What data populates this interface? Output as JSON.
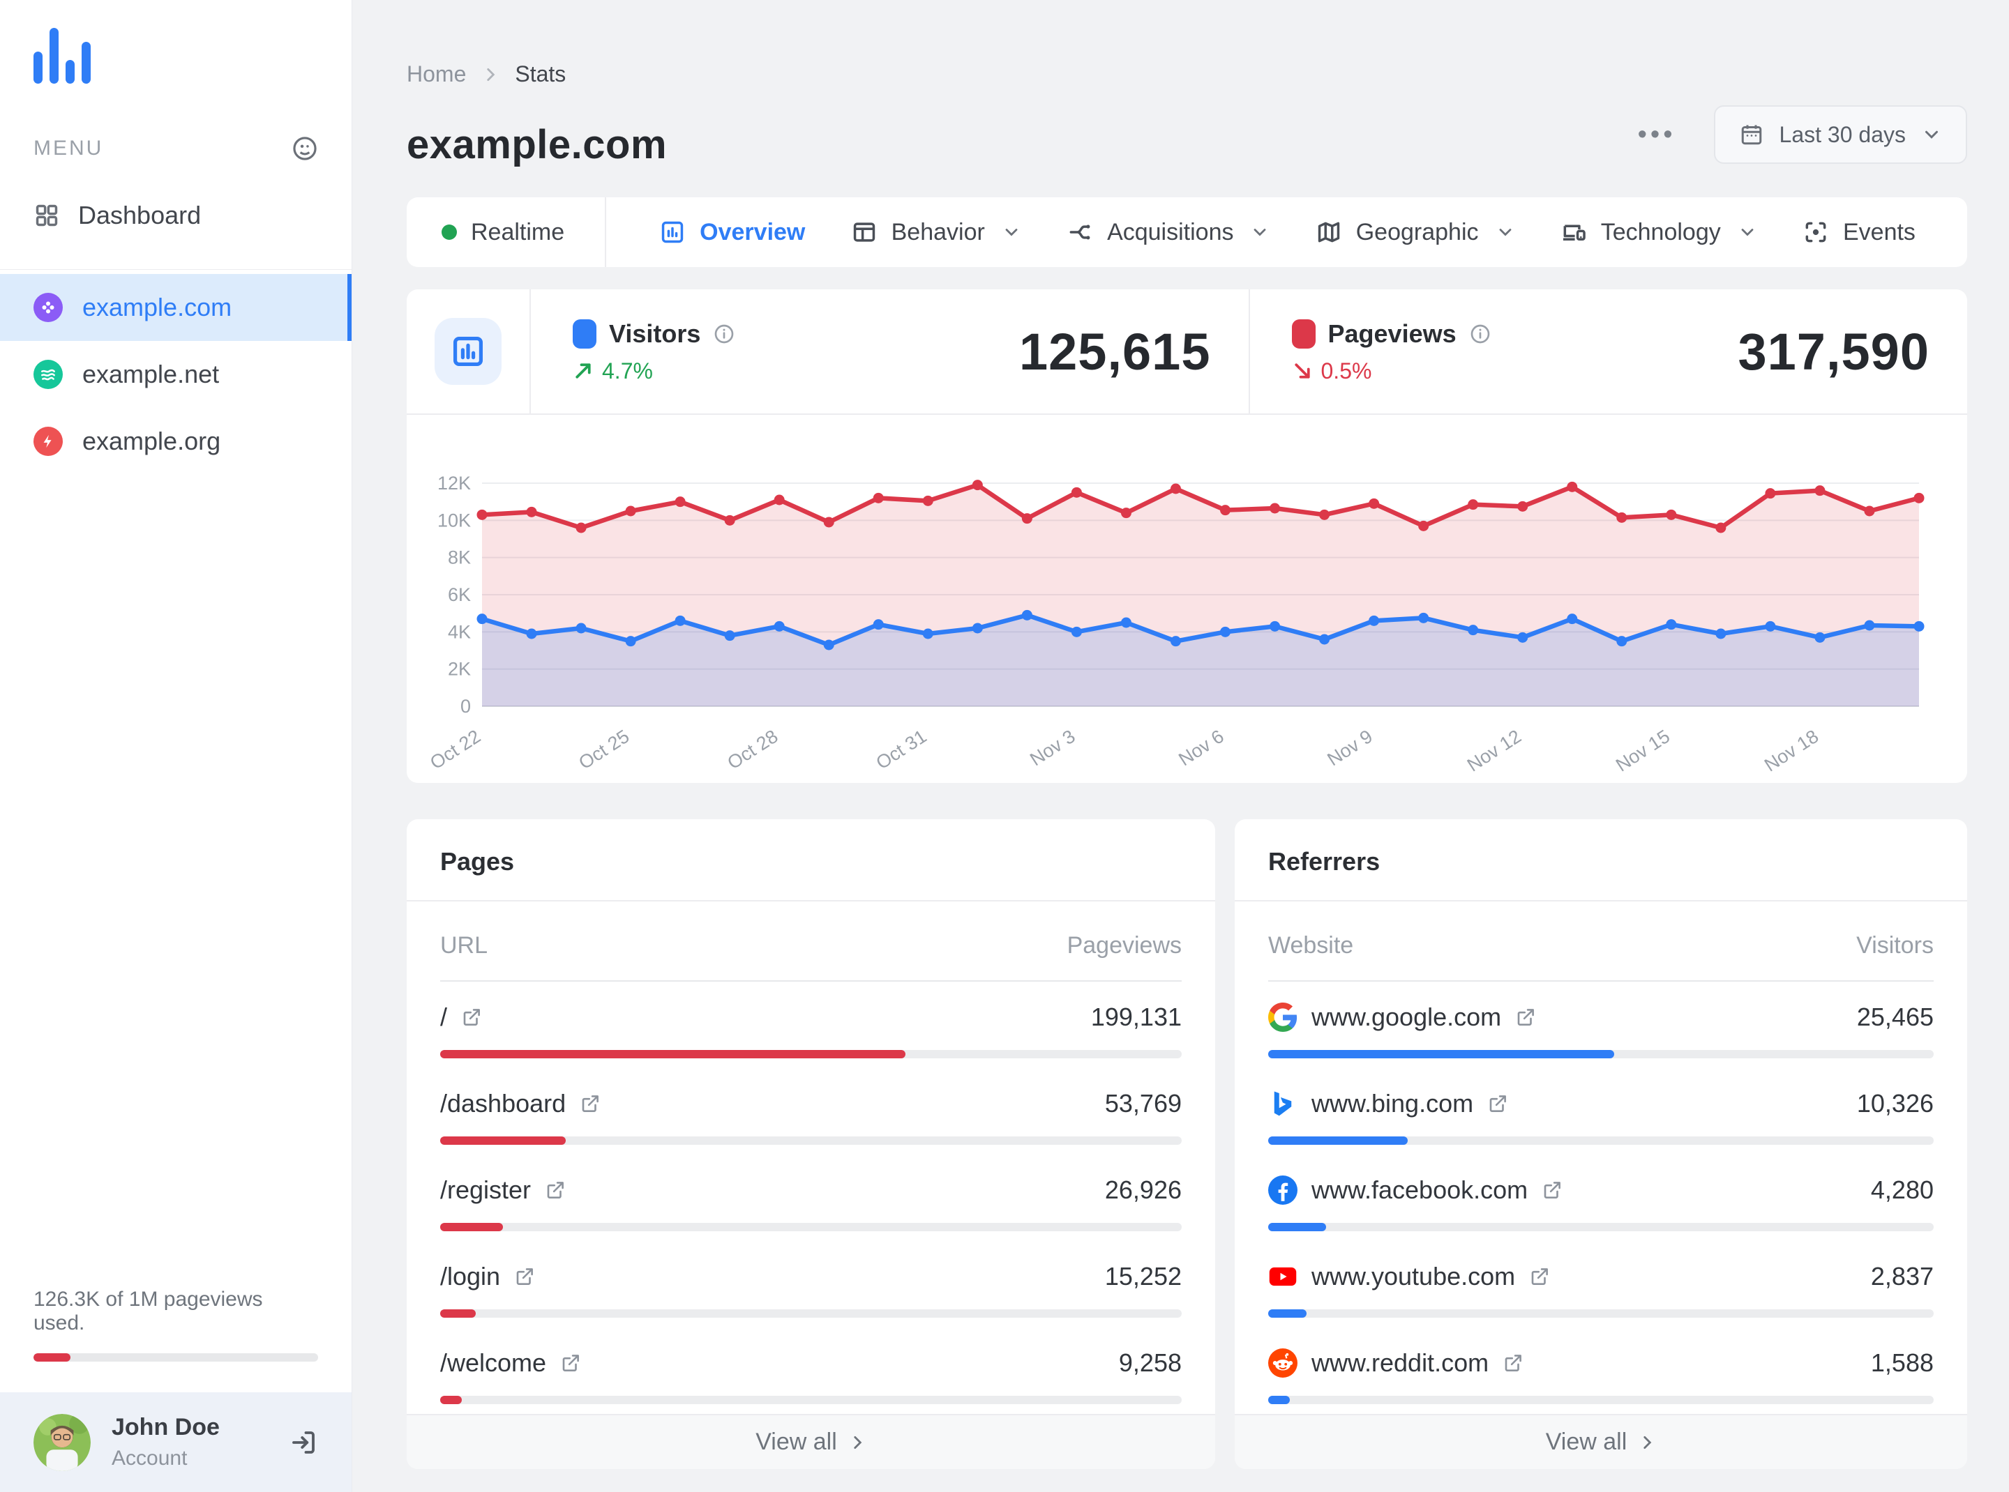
{
  "sidebar": {
    "menu_label": "MENU",
    "nav_dashboard": "Dashboard",
    "sites": [
      {
        "name": "example.com",
        "active": true,
        "color": "#8b5cf6"
      },
      {
        "name": "example.net",
        "active": false,
        "color": "#16c79a"
      },
      {
        "name": "example.org",
        "active": false,
        "color": "#ee5253"
      }
    ],
    "usage": {
      "text": "126.3K of 1M pageviews used.",
      "pct": 13
    },
    "user": {
      "name": "John Doe",
      "role": "Account"
    }
  },
  "header": {
    "breadcrumb": {
      "home": "Home",
      "current": "Stats"
    },
    "title": "example.com",
    "more_label": "•••",
    "date_range": "Last 30 days"
  },
  "tabs": [
    {
      "label": "Realtime"
    },
    {
      "label": "Overview",
      "active": true
    },
    {
      "label": "Behavior",
      "dropdown": true
    },
    {
      "label": "Acquisitions",
      "dropdown": true
    },
    {
      "label": "Geographic",
      "dropdown": true
    },
    {
      "label": "Technology",
      "dropdown": true
    },
    {
      "label": "Events"
    }
  ],
  "stats": {
    "visitors": {
      "label": "Visitors",
      "value": "125,615",
      "delta": "4.7%",
      "direction": "up",
      "color": "#2f7df6"
    },
    "pageviews": {
      "label": "Pageviews",
      "value": "317,590",
      "delta": "0.5%",
      "direction": "down",
      "color": "#dc3849"
    }
  },
  "chart_data": {
    "type": "area",
    "x": [
      "Oct 22",
      "Oct 23",
      "Oct 24",
      "Oct 25",
      "Oct 26",
      "Oct 27",
      "Oct 28",
      "Oct 29",
      "Oct 30",
      "Oct 31",
      "Nov 1",
      "Nov 2",
      "Nov 3",
      "Nov 4",
      "Nov 5",
      "Nov 6",
      "Nov 7",
      "Nov 8",
      "Nov 9",
      "Nov 10",
      "Nov 11",
      "Nov 12",
      "Nov 13",
      "Nov 14",
      "Nov 15",
      "Nov 16",
      "Nov 17",
      "Nov 18",
      "Nov 19",
      "Nov 20"
    ],
    "tick_every": 3,
    "ylim": [
      0,
      12000
    ],
    "yticks": [
      "0",
      "2K",
      "4K",
      "6K",
      "8K",
      "10K",
      "12K"
    ],
    "grid": true,
    "legend_position": "none",
    "series": [
      {
        "name": "Pageviews",
        "color": "#dc3849",
        "values": [
          10300,
          10450,
          9600,
          10500,
          11000,
          10000,
          11100,
          9900,
          11200,
          11050,
          11900,
          10100,
          11500,
          10400,
          11700,
          10550,
          10650,
          10300,
          10900,
          9700,
          10850,
          10750,
          11800,
          10150,
          10300,
          9600,
          11450,
          11600,
          10500,
          11200
        ]
      },
      {
        "name": "Visitors",
        "color": "#2f7df6",
        "values": [
          4700,
          3900,
          4200,
          3500,
          4600,
          3800,
          4300,
          3300,
          4400,
          3900,
          4200,
          4900,
          4000,
          4500,
          3500,
          4000,
          4300,
          3600,
          4600,
          4750,
          4100,
          3700,
          4700,
          3500,
          4400,
          3900,
          4300,
          3700,
          4350,
          4300
        ]
      }
    ]
  },
  "pages": {
    "title": "Pages",
    "columns": [
      "URL",
      "Pageviews"
    ],
    "rows": [
      {
        "url": "/",
        "value": "199,131",
        "pct": 62.7
      },
      {
        "url": "/dashboard",
        "value": "53,769",
        "pct": 16.9
      },
      {
        "url": "/register",
        "value": "26,926",
        "pct": 8.5
      },
      {
        "url": "/login",
        "value": "15,252",
        "pct": 4.8
      },
      {
        "url": "/welcome",
        "value": "9,258",
        "pct": 2.9
      }
    ],
    "footer": "View all"
  },
  "referrers": {
    "title": "Referrers",
    "columns": [
      "Website",
      "Visitors"
    ],
    "rows": [
      {
        "site": "www.google.com",
        "value": "25,465",
        "pct": 52,
        "icon": "google"
      },
      {
        "site": "www.bing.com",
        "value": "10,326",
        "pct": 21,
        "icon": "bing"
      },
      {
        "site": "www.facebook.com",
        "value": "4,280",
        "pct": 8.7,
        "icon": "facebook"
      },
      {
        "site": "www.youtube.com",
        "value": "2,837",
        "pct": 5.8,
        "icon": "youtube"
      },
      {
        "site": "www.reddit.com",
        "value": "1,588",
        "pct": 3.2,
        "icon": "reddit"
      }
    ],
    "footer": "View all"
  }
}
